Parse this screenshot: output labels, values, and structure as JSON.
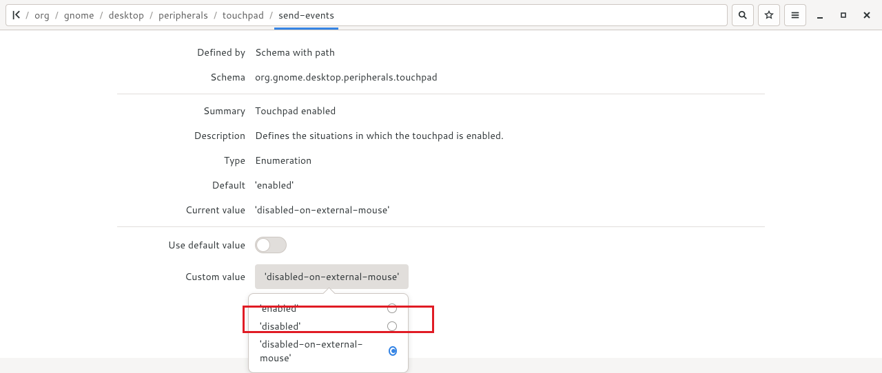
{
  "breadcrumbs": {
    "items": [
      "org",
      "gnome",
      "desktop",
      "peripherals",
      "touchpad",
      "send-events"
    ]
  },
  "details": {
    "defined_by_label": "Defined by",
    "defined_by_value": "Schema with path",
    "schema_label": "Schema",
    "schema_value": "org.gnome.desktop.peripherals.touchpad",
    "summary_label": "Summary",
    "summary_value": "Touchpad enabled",
    "description_label": "Description",
    "description_value": "Defines the situations in which the touchpad is enabled.",
    "type_label": "Type",
    "type_value": "Enumeration",
    "default_label": "Default",
    "default_value": "'enabled'",
    "current_label": "Current value",
    "current_value": "'disabled-on-external-mouse'",
    "use_default_label": "Use default value",
    "custom_label": "Custom value",
    "custom_value": "'disabled-on-external-mouse'"
  },
  "options": [
    {
      "label": "'enabled'",
      "selected": false
    },
    {
      "label": "'disabled'",
      "selected": false
    },
    {
      "label": "'disabled-on-external-mouse'",
      "selected": true
    }
  ]
}
